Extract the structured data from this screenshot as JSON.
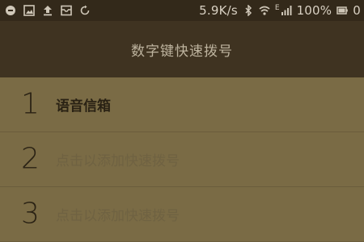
{
  "status_bar": {
    "speed": "5.9K/s",
    "network_type": "E",
    "battery": "100%",
    "time_partial": "0",
    "icons_left": [
      "chat-icon",
      "image-icon",
      "upload-icon",
      "inbox-icon",
      "sync-icon"
    ],
    "icons_right": [
      "bluetooth-icon",
      "wifi-icon",
      "signal-icon",
      "battery-icon"
    ]
  },
  "header": {
    "title": "数字键快速拨号"
  },
  "speed_dial": {
    "rows": [
      {
        "number": "1",
        "label": "语音信箱"
      },
      {
        "number": "2",
        "label": "点击以添加快速拨号"
      },
      {
        "number": "3",
        "label": "点击以添加快速拨号"
      }
    ]
  }
}
